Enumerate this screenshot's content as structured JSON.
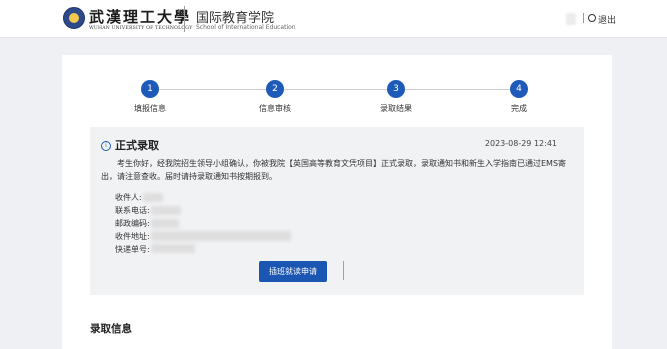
{
  "header": {
    "university_cn": "武漢理工大學",
    "university_en": "WUHAN UNIVERSITY OF TECHNOLOGY",
    "school_cn": "国际教育学院",
    "school_en": "School of International Education",
    "user_name": "",
    "logout_label": "退出"
  },
  "steps": [
    {
      "number": "1",
      "label": "填报信息"
    },
    {
      "number": "2",
      "label": "信息审核"
    },
    {
      "number": "3",
      "label": "录取结果"
    },
    {
      "number": "4",
      "label": "完成"
    }
  ],
  "notice": {
    "icon": "info-icon",
    "title": "正式录取",
    "time": "2023-08-29 12:41",
    "body": "考生你好，经我院招生领导小组确认，你被我院【英国高等教育文凭项目】正式录取，录取通知书和新生入学指南已通过EMS寄出，请注意查收。届时请持录取通知书按期报到。",
    "fields": [
      {
        "label": "收件人:",
        "value": ""
      },
      {
        "label": "联系电话:",
        "value": ""
      },
      {
        "label": "邮政编码:",
        "value": ""
      },
      {
        "label": "收件地址:",
        "value": ""
      },
      {
        "label": "快递单号:",
        "value": ""
      }
    ],
    "button_label": "插班就读申请"
  },
  "section": {
    "title": "录取信息"
  },
  "colors": {
    "primary": "#1e5bb8",
    "button": "#1b56b2",
    "background": "#eef0f3"
  }
}
